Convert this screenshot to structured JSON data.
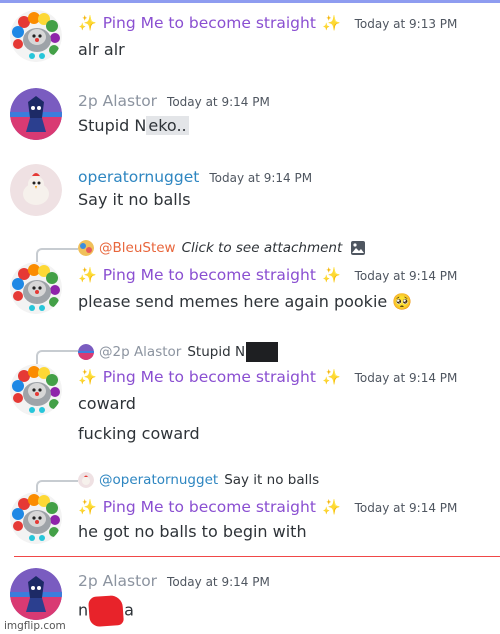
{
  "colors": {
    "accent_purple": "#8a4fd1",
    "alastor_gray": "#8c94a0",
    "operator_blue": "#2e86c1",
    "new_divider_red": "#f04747",
    "sparkle_gold": "#f2c21b"
  },
  "messages": [
    {
      "author": "Ping Me to become straight",
      "sparkle": "✨",
      "timestamp": "Today at 9:13 PM",
      "lines": [
        "alr alr"
      ]
    },
    {
      "author": "2p Alastor",
      "timestamp": "Today at 9:14 PM",
      "text_prefix": "Stupid N",
      "text_selected": "eko..",
      "lines": []
    },
    {
      "author": "operatornugget",
      "timestamp": "Today at 9:14 PM",
      "lines": [
        "Say it no balls"
      ]
    },
    {
      "reply_to": "@BleuStew",
      "reply_text": "Click to see attachment",
      "author": "Ping Me to become straight",
      "sparkle": "✨",
      "timestamp": "Today at 9:14 PM",
      "lines": [
        "please send memes here again pookie"
      ],
      "emoji": "🥺"
    },
    {
      "reply_to": "@2p Alastor",
      "reply_text": "Stupid N",
      "author": "Ping Me to become straight",
      "sparkle": "✨",
      "timestamp": "Today at 9:14 PM",
      "lines": [
        "coward",
        "fucking coward"
      ]
    },
    {
      "reply_to": "@operatornugget",
      "reply_text": "Say it no balls",
      "author": "Ping Me to become straight",
      "sparkle": "✨",
      "timestamp": "Today at 9:14 PM",
      "lines": [
        "he got no balls to begin with"
      ]
    },
    {
      "author": "2p Alastor",
      "timestamp": "Today at 9:14 PM",
      "text_start": "n",
      "text_end": "a",
      "lines": []
    }
  ],
  "watermark": "imgflip.com"
}
